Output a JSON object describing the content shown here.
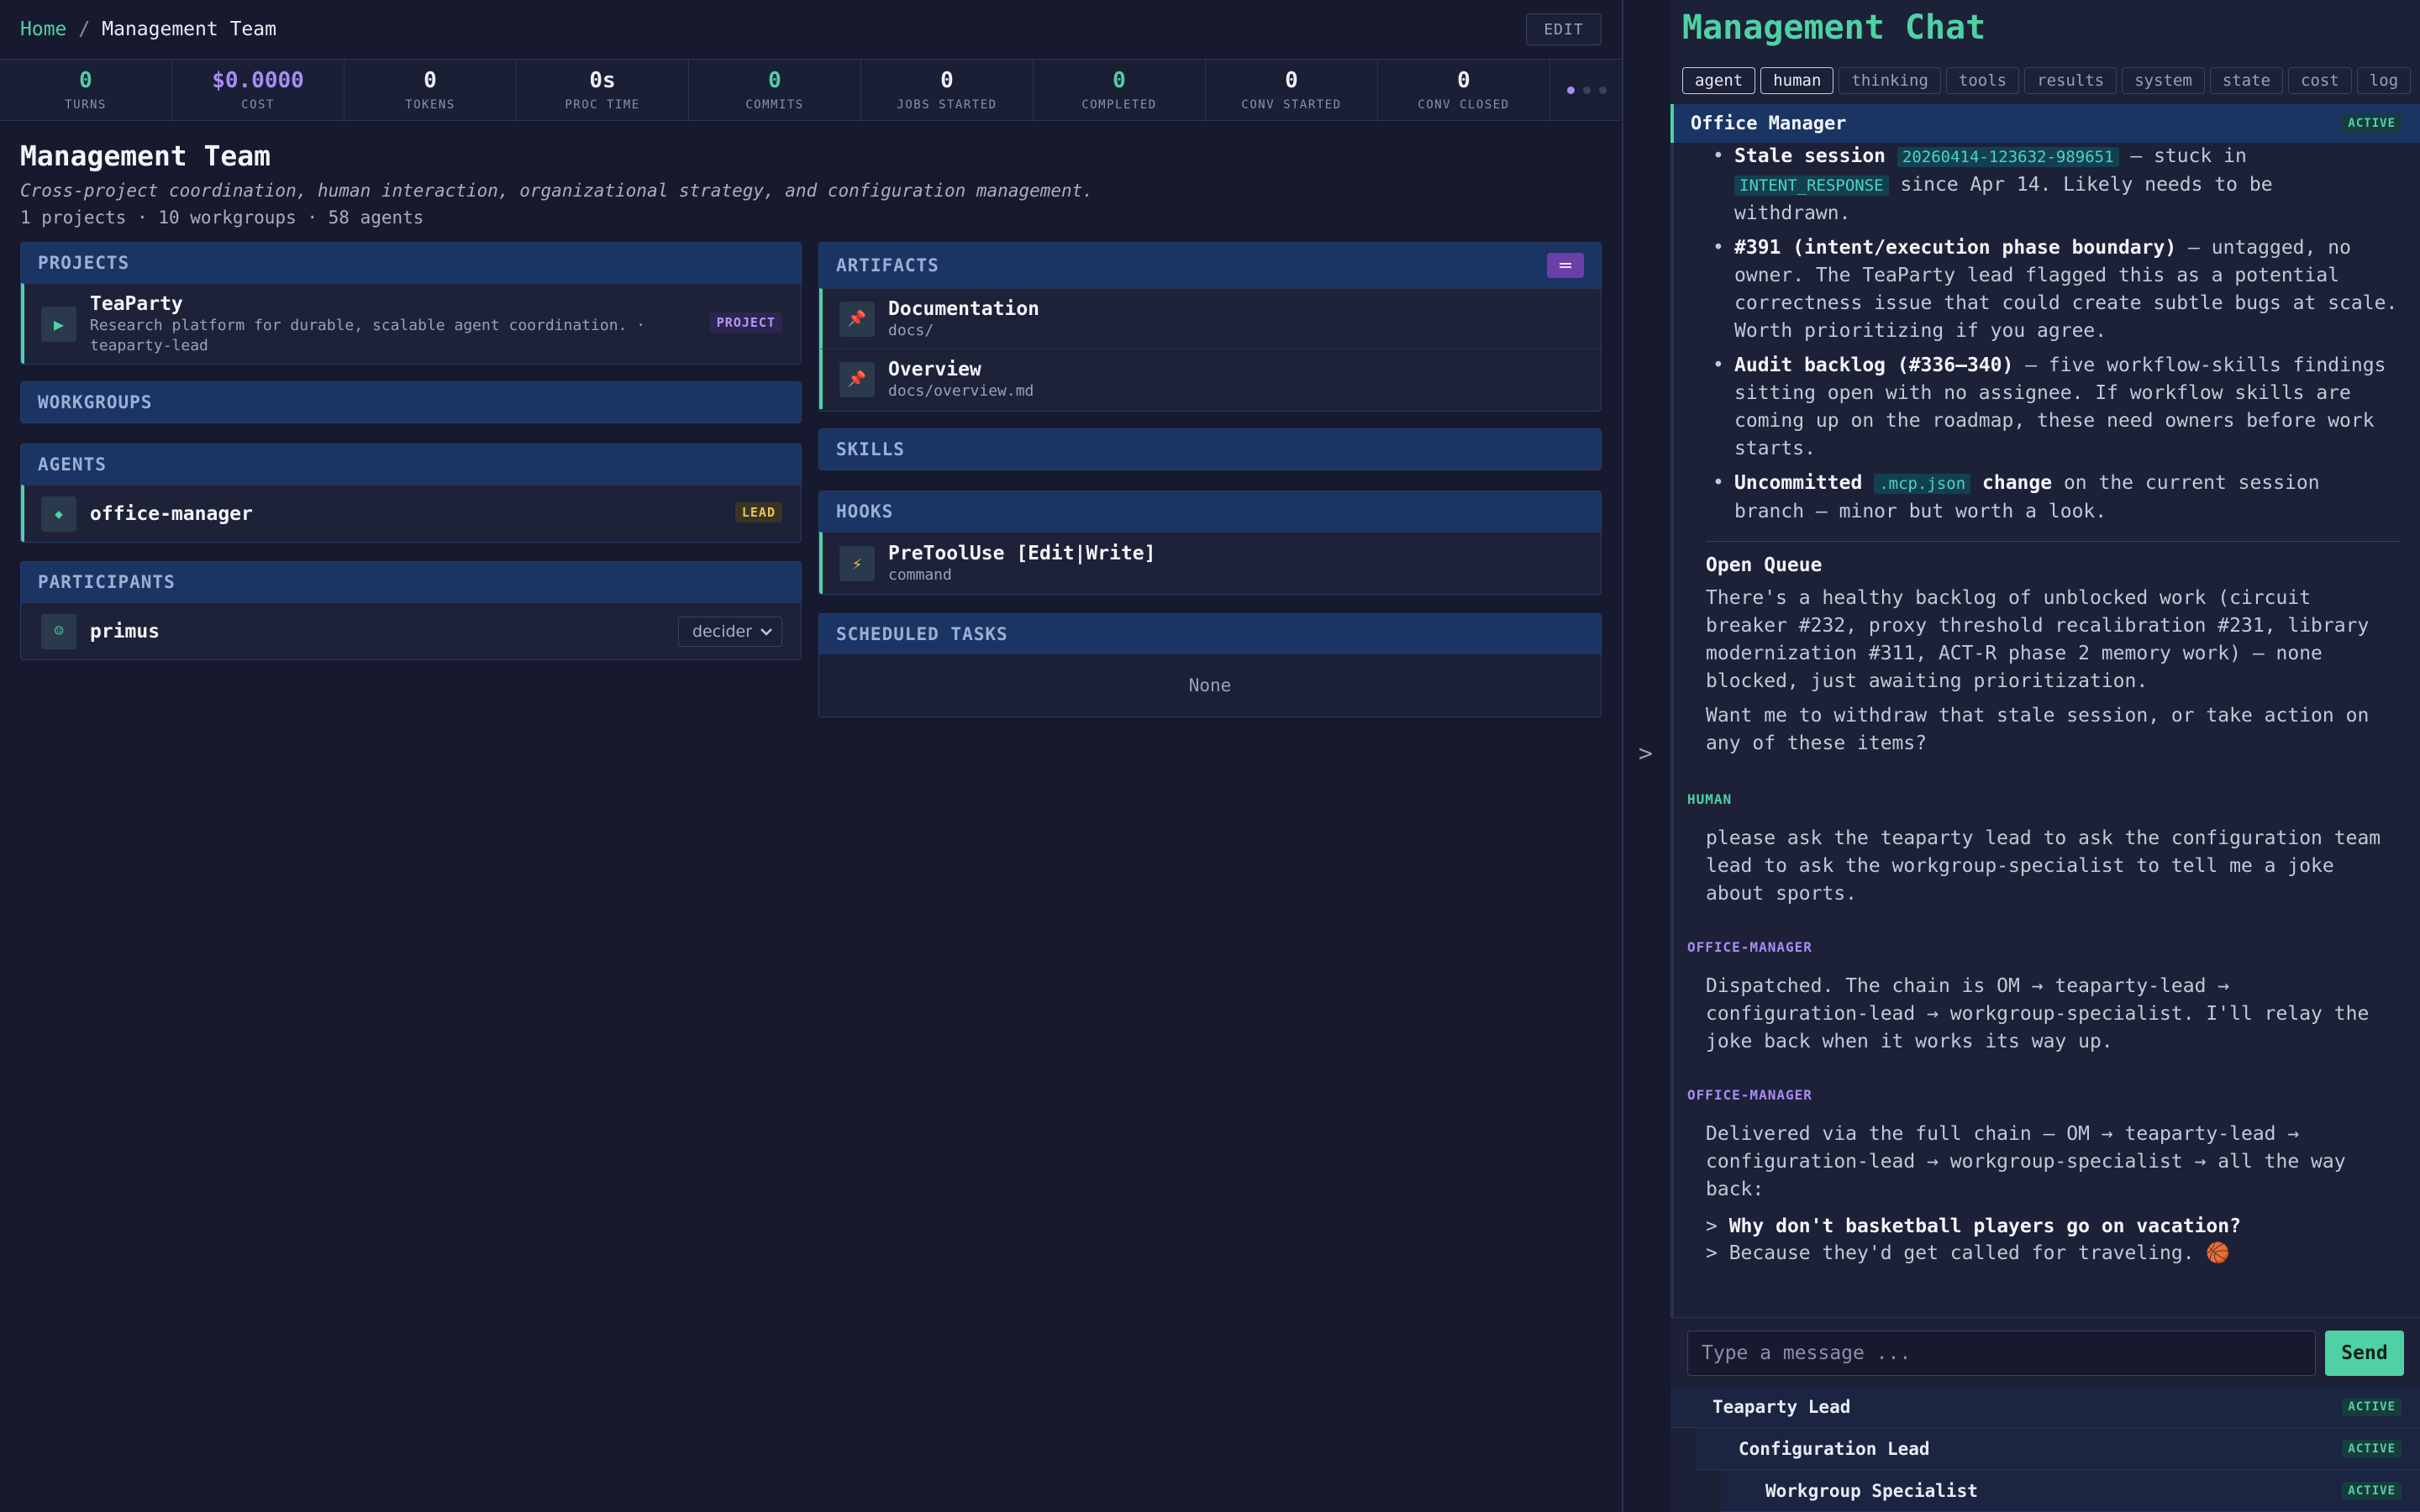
{
  "breadcrumb": {
    "home": "Home",
    "sep": "/",
    "current": "Management Team"
  },
  "edit_label": "EDIT",
  "stats": [
    {
      "value": "0",
      "label": "TURNS",
      "color": "teal"
    },
    {
      "value": "$0.0000",
      "label": "COST",
      "color": "purple"
    },
    {
      "value": "0",
      "label": "TOKENS",
      "color": "white"
    },
    {
      "value": "0s",
      "label": "PROC TIME",
      "color": "white"
    },
    {
      "value": "0",
      "label": "COMMITS",
      "color": "teal"
    },
    {
      "value": "0",
      "label": "JOBS STARTED",
      "color": "white"
    },
    {
      "value": "0",
      "label": "COMPLETED",
      "color": "teal"
    },
    {
      "value": "0",
      "label": "CONV STARTED",
      "color": "white"
    },
    {
      "value": "0",
      "label": "CONV CLOSED",
      "color": "white"
    }
  ],
  "team": {
    "title": "Management Team",
    "description": "Cross-project coordination, human interaction, organizational strategy, and configuration management.",
    "meta": "1 projects · 10 workgroups · 58 agents"
  },
  "projects": {
    "header": "PROJECTS",
    "items": [
      {
        "icon": "▶",
        "name": "TeaParty",
        "sub1": "Research platform for durable, scalable agent coordination. ·",
        "sub2": "teaparty-lead",
        "badge": "PROJECT"
      }
    ]
  },
  "workgroups": {
    "header": "WORKGROUPS"
  },
  "agents": {
    "header": "AGENTS",
    "items": [
      {
        "icon": "◆",
        "name": "office-manager",
        "badge": "LEAD"
      }
    ]
  },
  "participants": {
    "header": "PARTICIPANTS",
    "items": [
      {
        "icon": "☺",
        "name": "primus",
        "role": "decider"
      }
    ]
  },
  "artifacts": {
    "header": "ARTIFACTS",
    "items": [
      {
        "icon": "📌",
        "name": "Documentation",
        "path": "docs/"
      },
      {
        "icon": "📌",
        "name": "Overview",
        "path": "docs/overview.md"
      }
    ]
  },
  "skills": {
    "header": "SKILLS"
  },
  "hooks": {
    "header": "HOOKS",
    "items": [
      {
        "icon": "⚡",
        "name": "PreToolUse [Edit|Write]",
        "type": "command"
      }
    ]
  },
  "scheduled": {
    "header": "SCHEDULED TASKS",
    "empty": "None"
  },
  "collapse_label": ">",
  "chat": {
    "title": "Management Chat",
    "filters": [
      {
        "label": "agent",
        "on": true
      },
      {
        "label": "human",
        "on": true
      },
      {
        "label": "thinking",
        "on": false
      },
      {
        "label": "tools",
        "on": false
      },
      {
        "label": "results",
        "on": false
      },
      {
        "label": "system",
        "on": false
      },
      {
        "label": "state",
        "on": false
      },
      {
        "label": "cost",
        "on": false
      },
      {
        "label": "log",
        "on": false
      }
    ],
    "conversation": {
      "name": "Office Manager",
      "status": "ACTIVE"
    },
    "bullets": [
      {
        "bold": "Stale session",
        "code1": "20260414-123632-989651",
        "t1": " — stuck in",
        "code2": "INTENT_RESPONSE",
        "t2": " since Apr 14. Likely needs to be withdrawn."
      },
      {
        "bold": "#391 (intent/execution phase boundary)",
        "t1": " — untagged, no owner. The TeaParty lead flagged this as a potential correctness issue that could create subtle bugs at scale. Worth prioritizing if you agree."
      },
      {
        "bold": "Audit backlog (#336–340)",
        "t1": " — five workflow-skills findings sitting open with no assignee. If workflow skills are coming up on the roadmap, these need owners before work starts."
      },
      {
        "bold": "Uncommitted",
        "code1": ".mcp.json",
        "bold2": "change",
        "t1": " on the current session branch — minor but worth a look."
      }
    ],
    "open_queue_title": "Open Queue",
    "open_queue_text": "There's a healthy backlog of unblocked work (circuit breaker #232, proxy threshold recalibration #231, library modernization #311, ACT-R phase 2 memory work) — none blocked, just awaiting prioritization.",
    "open_queue_ask": "Want me to withdraw that stale session, or take action on any of these items?",
    "messages": [
      {
        "sender": "HUMAN",
        "text": "please ask the teaparty lead to ask the configuration team lead to ask the workgroup-specialist to tell me a joke about sports."
      },
      {
        "sender": "OFFICE-MANAGER",
        "text": "Dispatched. The chain is OM → teaparty-lead → configuration-lead → workgroup-specialist. I'll relay the joke back when it works its way up."
      },
      {
        "sender": "OFFICE-MANAGER",
        "text": "Delivered via the full chain — OM → teaparty-lead → configuration-lead → workgroup-specialist → all the way back:",
        "quote1": "Why don't basketball players go on vacation?",
        "quote2": "Because they'd get called for traveling. 🏀"
      }
    ],
    "input_placeholder": "Type a message ...",
    "send_label": "Send",
    "sub_conversations": [
      {
        "name": "Teaparty Lead",
        "status": "ACTIVE"
      },
      {
        "name": "Configuration Lead",
        "status": "ACTIVE"
      },
      {
        "name": "Workgroup Specialist",
        "status": "ACTIVE"
      }
    ]
  },
  "colors": {
    "accent": "#4fd1a5",
    "purple": "#a98bf5",
    "bg": "#171a2e",
    "panel_head": "#1a3564"
  }
}
